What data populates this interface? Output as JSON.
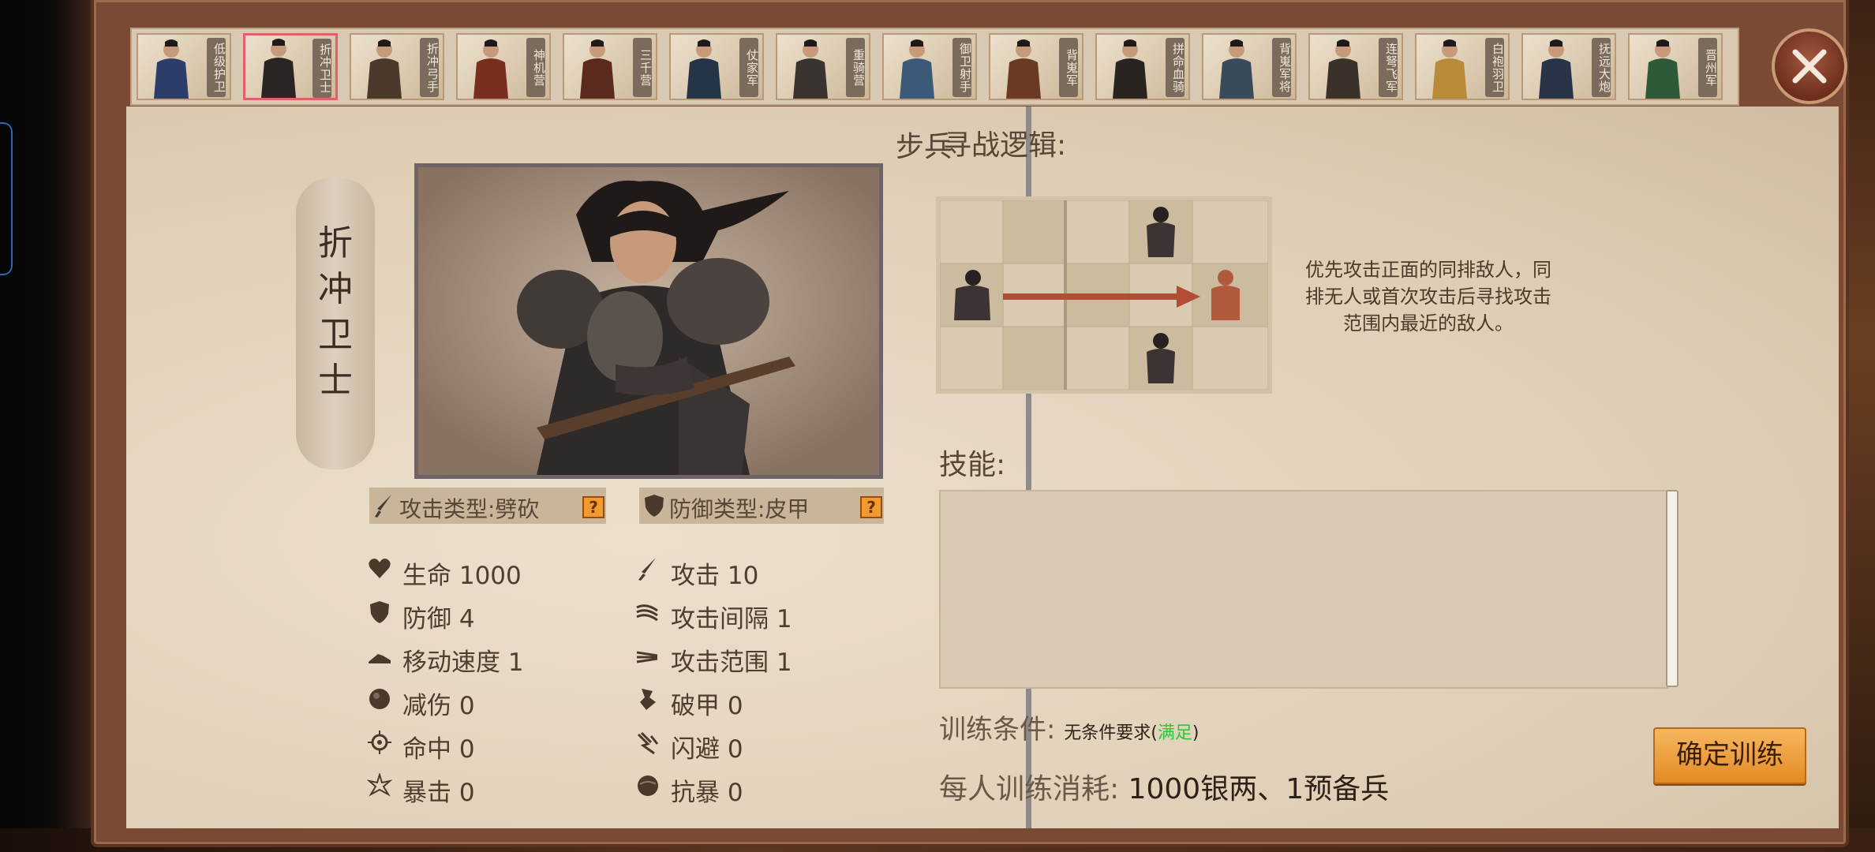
{
  "top_bar": {
    "units": [
      {
        "name": "低级护卫",
        "active": false
      },
      {
        "name": "折冲卫士",
        "active": true
      },
      {
        "name": "折冲弓手",
        "active": false
      },
      {
        "name": "神机营",
        "active": false
      },
      {
        "name": "三千营",
        "active": false
      },
      {
        "name": "仗家军",
        "active": false
      },
      {
        "name": "重骑营",
        "active": false
      },
      {
        "name": "御卫射手",
        "active": false
      },
      {
        "name": "背嵬军",
        "active": false
      },
      {
        "name": "拼命血骑",
        "active": false
      },
      {
        "name": "背嵬军将",
        "active": false
      },
      {
        "name": "连弩飞军",
        "active": false
      },
      {
        "name": "白袍羽卫",
        "active": false
      },
      {
        "name": "抚远大炮",
        "active": false
      },
      {
        "name": "晋州军",
        "active": false
      }
    ]
  },
  "close_icon": "close-icon",
  "unit": {
    "category": "步兵",
    "name": "折冲卫士",
    "attack_type": "攻击类型:劈砍",
    "defense_type": "防御类型:皮甲",
    "help_mark": "?"
  },
  "stats_left": [
    {
      "icon": "heart-icon",
      "label": "生命 1000"
    },
    {
      "icon": "shield-icon",
      "label": "防御 4"
    },
    {
      "icon": "boot-icon",
      "label": "移动速度 1"
    },
    {
      "icon": "damage-reduction-icon",
      "label": "减伤 0"
    },
    {
      "icon": "crosshair-icon",
      "label": "命中 0"
    },
    {
      "icon": "crit-icon",
      "label": "暴击 0"
    }
  ],
  "stats_right": [
    {
      "icon": "sword-icon",
      "label": "攻击 10"
    },
    {
      "icon": "attack-interval-icon",
      "label": "攻击间隔 1"
    },
    {
      "icon": "attack-range-icon",
      "label": "攻击范围 1"
    },
    {
      "icon": "armor-break-icon",
      "label": "破甲 0"
    },
    {
      "icon": "dodge-icon",
      "label": "闪避 0"
    },
    {
      "icon": "crit-resist-icon",
      "label": "抗暴 0"
    }
  ],
  "logic": {
    "title": "寻战逻辑:",
    "description": "优先攻击正面的同排敌人，同排无人或首次攻击后寻找攻击范围内最近的敌人。"
  },
  "skills": {
    "title": "技能:"
  },
  "training": {
    "condition_label": "训练条件:",
    "condition_value": "无条件要求(",
    "condition_status": "满足",
    "condition_close": ")",
    "cost_label": "每人训练消耗:",
    "cost_value": "1000银两、1预备兵",
    "confirm_button": "确定训练"
  },
  "colors": {
    "active_border": "#e2606a",
    "confirm_button": "#f0a040",
    "status_ok": "#22cc33"
  }
}
